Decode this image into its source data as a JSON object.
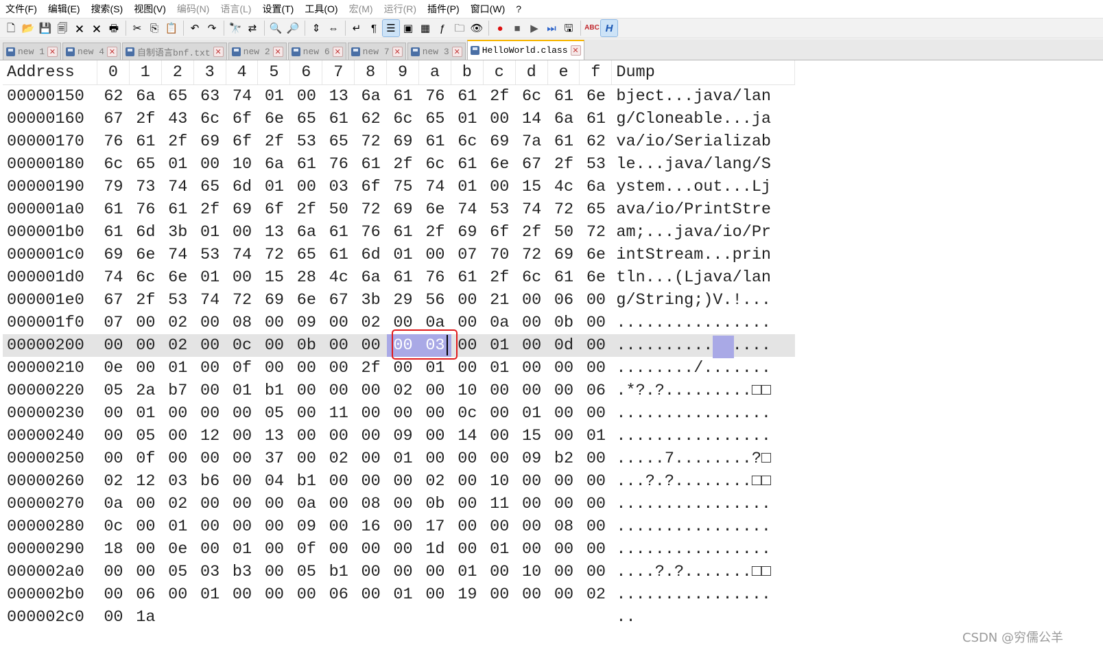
{
  "menu": [
    "文件(F)",
    "编辑(E)",
    "搜索(S)",
    "视图(V)",
    "编码(N)",
    "语言(L)",
    "设置(T)",
    "工具(O)",
    "宏(M)",
    "运行(R)",
    "插件(P)",
    "窗口(W)",
    "?"
  ],
  "menu_dim": [
    false,
    false,
    false,
    false,
    true,
    true,
    false,
    false,
    true,
    true,
    false,
    false,
    false
  ],
  "toolbar": [
    {
      "name": "new-file-icon",
      "glyph": "🗋"
    },
    {
      "name": "open-file-icon",
      "glyph": "📂"
    },
    {
      "name": "save-icon",
      "glyph": "💾"
    },
    {
      "name": "save-all-icon",
      "glyph": "🗐"
    },
    {
      "name": "close-icon",
      "glyph": "🗙"
    },
    {
      "name": "close-all-icon",
      "glyph": "🗙"
    },
    {
      "name": "print-icon",
      "glyph": "🖶"
    },
    {
      "sep": true
    },
    {
      "name": "cut-icon",
      "glyph": "✂"
    },
    {
      "name": "copy-icon",
      "glyph": "⎘"
    },
    {
      "name": "paste-icon",
      "glyph": "📋"
    },
    {
      "sep": true
    },
    {
      "name": "undo-icon",
      "glyph": "↶"
    },
    {
      "name": "redo-icon",
      "glyph": "↷"
    },
    {
      "sep": true
    },
    {
      "name": "find-icon",
      "glyph": "🔭"
    },
    {
      "name": "replace-icon",
      "glyph": "⇄"
    },
    {
      "sep": true
    },
    {
      "name": "zoom-in-icon",
      "glyph": "🔍"
    },
    {
      "name": "zoom-out-icon",
      "glyph": "🔎"
    },
    {
      "sep": true
    },
    {
      "name": "sync-vertical-icon",
      "glyph": "⇕"
    },
    {
      "name": "sync-horizontal-icon",
      "glyph": "⇔"
    },
    {
      "sep": true
    },
    {
      "name": "word-wrap-icon",
      "glyph": "↵"
    },
    {
      "name": "show-all-chars-icon",
      "glyph": "¶"
    },
    {
      "name": "indent-guide-icon",
      "glyph": "☰",
      "active": true
    },
    {
      "name": "language-icon",
      "glyph": "▣"
    },
    {
      "name": "doc-map-icon",
      "glyph": "▦"
    },
    {
      "name": "function-list-icon",
      "glyph": "ƒ"
    },
    {
      "name": "folder-workspace-icon",
      "glyph": "🗀"
    },
    {
      "name": "monitor-icon",
      "glyph": "👁"
    },
    {
      "sep": true
    },
    {
      "name": "record-macro-icon",
      "glyph": "●",
      "color": "#d11"
    },
    {
      "name": "stop-macro-icon",
      "glyph": "■",
      "color": "#555"
    },
    {
      "name": "play-macro-icon",
      "glyph": "▶",
      "color": "#555"
    },
    {
      "name": "run-macro-multiple-icon",
      "glyph": "⏭",
      "color": "#2a62c9"
    },
    {
      "name": "save-macro-icon",
      "glyph": "🖫"
    },
    {
      "sep": true
    },
    {
      "name": "spellcheck-icon",
      "glyph": "ABC",
      "color": "#c1272d"
    },
    {
      "name": "hex-editor-icon",
      "glyph": "H",
      "color": "#1b57b3",
      "active": true
    }
  ],
  "tabs": [
    {
      "label": "new 1",
      "active": false
    },
    {
      "label": "new 4",
      "active": false
    },
    {
      "label": "自制语言bnf.txt",
      "active": false
    },
    {
      "label": "new 2",
      "active": false
    },
    {
      "label": "new 6",
      "active": false
    },
    {
      "label": "new 7",
      "active": false
    },
    {
      "label": "new 3",
      "active": false
    },
    {
      "label": "HelloWorld.class",
      "active": true
    }
  ],
  "hex": {
    "header": {
      "address": "Address",
      "cols": [
        "0",
        "1",
        "2",
        "3",
        "4",
        "5",
        "6",
        "7",
        "8",
        "9",
        "a",
        "b",
        "c",
        "d",
        "e",
        "f"
      ],
      "dump": "Dump"
    },
    "rows": [
      {
        "addr": "00000150",
        "bytes": [
          "62",
          "6a",
          "65",
          "63",
          "74",
          "01",
          "00",
          "13",
          "6a",
          "61",
          "76",
          "61",
          "2f",
          "6c",
          "61",
          "6e"
        ],
        "dump": "bject...java/lan"
      },
      {
        "addr": "00000160",
        "bytes": [
          "67",
          "2f",
          "43",
          "6c",
          "6f",
          "6e",
          "65",
          "61",
          "62",
          "6c",
          "65",
          "01",
          "00",
          "14",
          "6a",
          "61"
        ],
        "dump": "g/Cloneable...ja"
      },
      {
        "addr": "00000170",
        "bytes": [
          "76",
          "61",
          "2f",
          "69",
          "6f",
          "2f",
          "53",
          "65",
          "72",
          "69",
          "61",
          "6c",
          "69",
          "7a",
          "61",
          "62"
        ],
        "dump": "va/io/Serializab"
      },
      {
        "addr": "00000180",
        "bytes": [
          "6c",
          "65",
          "01",
          "00",
          "10",
          "6a",
          "61",
          "76",
          "61",
          "2f",
          "6c",
          "61",
          "6e",
          "67",
          "2f",
          "53"
        ],
        "dump": "le...java/lang/S"
      },
      {
        "addr": "00000190",
        "bytes": [
          "79",
          "73",
          "74",
          "65",
          "6d",
          "01",
          "00",
          "03",
          "6f",
          "75",
          "74",
          "01",
          "00",
          "15",
          "4c",
          "6a"
        ],
        "dump": "ystem...out...Lj"
      },
      {
        "addr": "000001a0",
        "bytes": [
          "61",
          "76",
          "61",
          "2f",
          "69",
          "6f",
          "2f",
          "50",
          "72",
          "69",
          "6e",
          "74",
          "53",
          "74",
          "72",
          "65"
        ],
        "dump": "ava/io/PrintStre"
      },
      {
        "addr": "000001b0",
        "bytes": [
          "61",
          "6d",
          "3b",
          "01",
          "00",
          "13",
          "6a",
          "61",
          "76",
          "61",
          "2f",
          "69",
          "6f",
          "2f",
          "50",
          "72"
        ],
        "dump": "am;...java/io/Pr"
      },
      {
        "addr": "000001c0",
        "bytes": [
          "69",
          "6e",
          "74",
          "53",
          "74",
          "72",
          "65",
          "61",
          "6d",
          "01",
          "00",
          "07",
          "70",
          "72",
          "69",
          "6e"
        ],
        "dump": "intStream...prin"
      },
      {
        "addr": "000001d0",
        "bytes": [
          "74",
          "6c",
          "6e",
          "01",
          "00",
          "15",
          "28",
          "4c",
          "6a",
          "61",
          "76",
          "61",
          "2f",
          "6c",
          "61",
          "6e"
        ],
        "dump": "tln...(Ljava/lan"
      },
      {
        "addr": "000001e0",
        "bytes": [
          "67",
          "2f",
          "53",
          "74",
          "72",
          "69",
          "6e",
          "67",
          "3b",
          "29",
          "56",
          "00",
          "21",
          "00",
          "06",
          "00"
        ],
        "dump": "g/String;)V.!..."
      },
      {
        "addr": "000001f0",
        "bytes": [
          "07",
          "00",
          "02",
          "00",
          "08",
          "00",
          "09",
          "00",
          "02",
          "00",
          "0a",
          "00",
          "0a",
          "00",
          "0b",
          "00"
        ],
        "dump": "................"
      },
      {
        "addr": "00000200",
        "bytes": [
          "00",
          "00",
          "02",
          "00",
          "0c",
          "00",
          "0b",
          "00",
          "00",
          "00",
          "03",
          "00",
          "01",
          "00",
          "0d",
          "00"
        ],
        "dump": "................",
        "selected": true
      },
      {
        "addr": "00000210",
        "bytes": [
          "0e",
          "00",
          "01",
          "00",
          "0f",
          "00",
          "00",
          "00",
          "2f",
          "00",
          "01",
          "00",
          "01",
          "00",
          "00",
          "00"
        ],
        "dump": "......../......."
      },
      {
        "addr": "00000220",
        "bytes": [
          "05",
          "2a",
          "b7",
          "00",
          "01",
          "b1",
          "00",
          "00",
          "00",
          "02",
          "00",
          "10",
          "00",
          "00",
          "00",
          "06"
        ],
        "dump": ".*?.?.........□□"
      },
      {
        "addr": "00000230",
        "bytes": [
          "00",
          "01",
          "00",
          "00",
          "00",
          "05",
          "00",
          "11",
          "00",
          "00",
          "00",
          "0c",
          "00",
          "01",
          "00",
          "00"
        ],
        "dump": "................"
      },
      {
        "addr": "00000240",
        "bytes": [
          "00",
          "05",
          "00",
          "12",
          "00",
          "13",
          "00",
          "00",
          "00",
          "09",
          "00",
          "14",
          "00",
          "15",
          "00",
          "01"
        ],
        "dump": "................"
      },
      {
        "addr": "00000250",
        "bytes": [
          "00",
          "0f",
          "00",
          "00",
          "00",
          "37",
          "00",
          "02",
          "00",
          "01",
          "00",
          "00",
          "00",
          "09",
          "b2",
          "00"
        ],
        "dump": ".....7........?□"
      },
      {
        "addr": "00000260",
        "bytes": [
          "02",
          "12",
          "03",
          "b6",
          "00",
          "04",
          "b1",
          "00",
          "00",
          "00",
          "02",
          "00",
          "10",
          "00",
          "00",
          "00"
        ],
        "dump": "...?.?........□□"
      },
      {
        "addr": "00000270",
        "bytes": [
          "0a",
          "00",
          "02",
          "00",
          "00",
          "00",
          "0a",
          "00",
          "08",
          "00",
          "0b",
          "00",
          "11",
          "00",
          "00",
          "00"
        ],
        "dump": "................"
      },
      {
        "addr": "00000280",
        "bytes": [
          "0c",
          "00",
          "01",
          "00",
          "00",
          "00",
          "09",
          "00",
          "16",
          "00",
          "17",
          "00",
          "00",
          "00",
          "08",
          "00"
        ],
        "dump": "................"
      },
      {
        "addr": "00000290",
        "bytes": [
          "18",
          "00",
          "0e",
          "00",
          "01",
          "00",
          "0f",
          "00",
          "00",
          "00",
          "1d",
          "00",
          "01",
          "00",
          "00",
          "00"
        ],
        "dump": "................"
      },
      {
        "addr": "000002a0",
        "bytes": [
          "00",
          "00",
          "05",
          "03",
          "b3",
          "00",
          "05",
          "b1",
          "00",
          "00",
          "00",
          "01",
          "00",
          "10",
          "00",
          "00"
        ],
        "dump": "....?.?.......□□"
      },
      {
        "addr": "000002b0",
        "bytes": [
          "00",
          "06",
          "00",
          "01",
          "00",
          "00",
          "00",
          "06",
          "00",
          "01",
          "00",
          "19",
          "00",
          "00",
          "00",
          "02"
        ],
        "dump": "................"
      },
      {
        "addr": "000002c0",
        "bytes": [
          "00",
          "1a"
        ],
        "dump": ".."
      }
    ]
  },
  "watermark": "CSDN @穷儒公羊"
}
